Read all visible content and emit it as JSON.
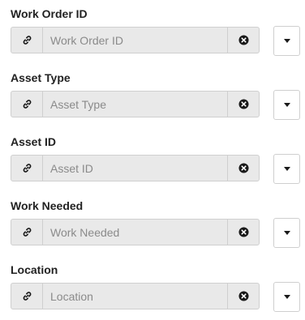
{
  "fields": [
    {
      "label": "Work Order ID",
      "placeholder": "Work Order ID",
      "value": ""
    },
    {
      "label": "Asset Type",
      "placeholder": "Asset Type",
      "value": ""
    },
    {
      "label": "Asset ID",
      "placeholder": "Asset ID",
      "value": ""
    },
    {
      "label": "Work Needed",
      "placeholder": "Work Needed",
      "value": ""
    },
    {
      "label": "Location",
      "placeholder": "Location",
      "value": ""
    }
  ],
  "icons": {
    "link": "link-icon",
    "clear": "clear-circle-x-icon",
    "dropdown": "caret-down-icon"
  },
  "colors": {
    "label": "#222222",
    "input_background": "#e9e9e9",
    "border": "#cfcfcf",
    "placeholder": "#8a8a8a",
    "icon": "#1a1a1a"
  }
}
